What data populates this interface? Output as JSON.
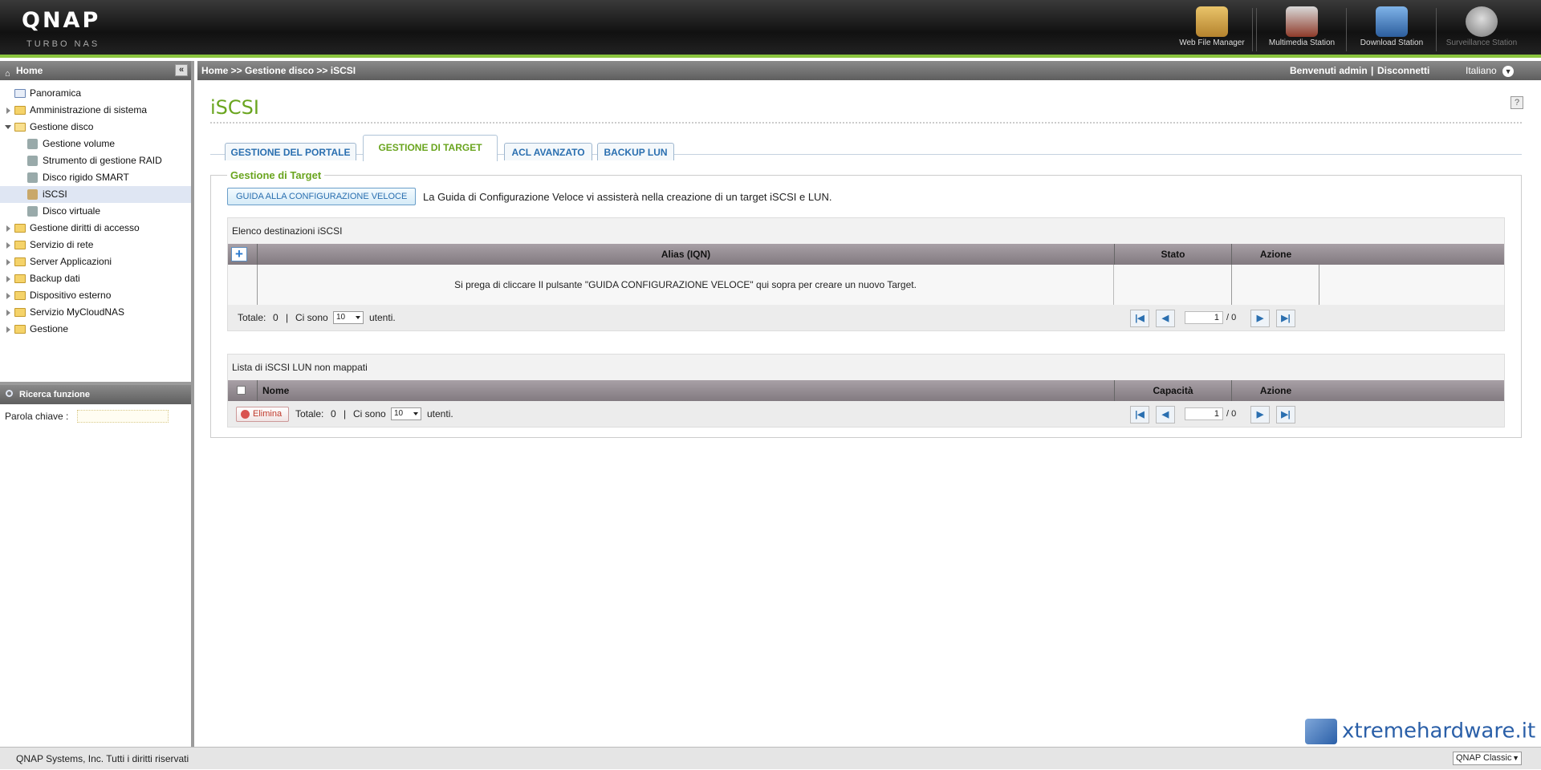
{
  "header": {
    "logo": "QNAP",
    "logo_sub": "TURBO NAS",
    "apps": [
      {
        "label": "Web File Manager",
        "icon": "web-file-manager-icon"
      },
      {
        "label": "Multimedia Station",
        "icon": "multimedia-station-icon"
      },
      {
        "label": "Download Station",
        "icon": "download-station-icon"
      },
      {
        "label": "Surveillance Station",
        "icon": "surveillance-station-icon"
      }
    ]
  },
  "sidebar": {
    "title": "Home",
    "items": [
      {
        "label": "Panoramica"
      },
      {
        "label": "Amministrazione di sistema"
      },
      {
        "label": "Gestione disco"
      },
      {
        "label": "Gestione volume"
      },
      {
        "label": "Strumento di gestione RAID"
      },
      {
        "label": "Disco rigido SMART"
      },
      {
        "label": "iSCSI"
      },
      {
        "label": "Disco virtuale"
      },
      {
        "label": "Gestione diritti di accesso"
      },
      {
        "label": "Servizio di rete"
      },
      {
        "label": "Server Applicazioni"
      },
      {
        "label": "Backup dati"
      },
      {
        "label": "Dispositivo esterno"
      },
      {
        "label": "Servizio MyCloudNAS"
      },
      {
        "label": "Gestione"
      }
    ],
    "search": {
      "title": "Ricerca funzione",
      "keyword_label": "Parola chiave :"
    }
  },
  "topbar": {
    "breadcrumb": "Home >> Gestione disco >> iSCSI",
    "welcome": "Benvenuti admin",
    "separator": "|",
    "logout": "Disconnetti",
    "language": "Italiano"
  },
  "main": {
    "title": "iSCSI",
    "help": "?",
    "tabs": [
      {
        "label": "GESTIONE DEL PORTALE"
      },
      {
        "label": "GESTIONE DI TARGET"
      },
      {
        "label": "ACL AVANZATO"
      },
      {
        "label": "BACKUP LUN"
      }
    ],
    "group_title": "Gestione di Target",
    "wizard_button": "GUIDA ALLA CONFIGURAZIONE VELOCE",
    "wizard_text": "La Guida di Configurazione Veloce vi assisterà nella creazione di un target iSCSI e LUN.",
    "targets": {
      "caption": "Elenco destinazioni iSCSI",
      "col_alias": "Alias (IQN)",
      "col_status": "Stato",
      "col_action": "Azione",
      "empty_message": "Si prega di cliccare Il pulsante \"GUIDA CONFIGURAZIONE VELOCE\" qui sopra per creare un nuovo Target.",
      "total_label": "Totale:",
      "total": "0",
      "sep": "|",
      "per_page_label": "Ci sono",
      "per_page": "10",
      "users_label": "utenti.",
      "page": "1",
      "pages": "/ 0"
    },
    "luns": {
      "caption": "Lista di iSCSI LUN non mappati",
      "col_name": "Nome",
      "col_capacity": "Capacità",
      "col_action": "Azione",
      "delete_button": "Elimina",
      "total_label": "Totale:",
      "total": "0",
      "sep": "|",
      "per_page_label": "Ci sono",
      "per_page": "10",
      "users_label": "utenti.",
      "page": "1",
      "pages": "/ 0"
    }
  },
  "footer": {
    "copyright": "QNAP Systems, Inc. Tutti i diritti riservati",
    "theme": "QNAP Classic",
    "watermark": "xtremehardware.it"
  },
  "colors": {
    "accent": "#6aa51f",
    "link": "#2a6fb0",
    "header_line": "#8cc63f"
  }
}
